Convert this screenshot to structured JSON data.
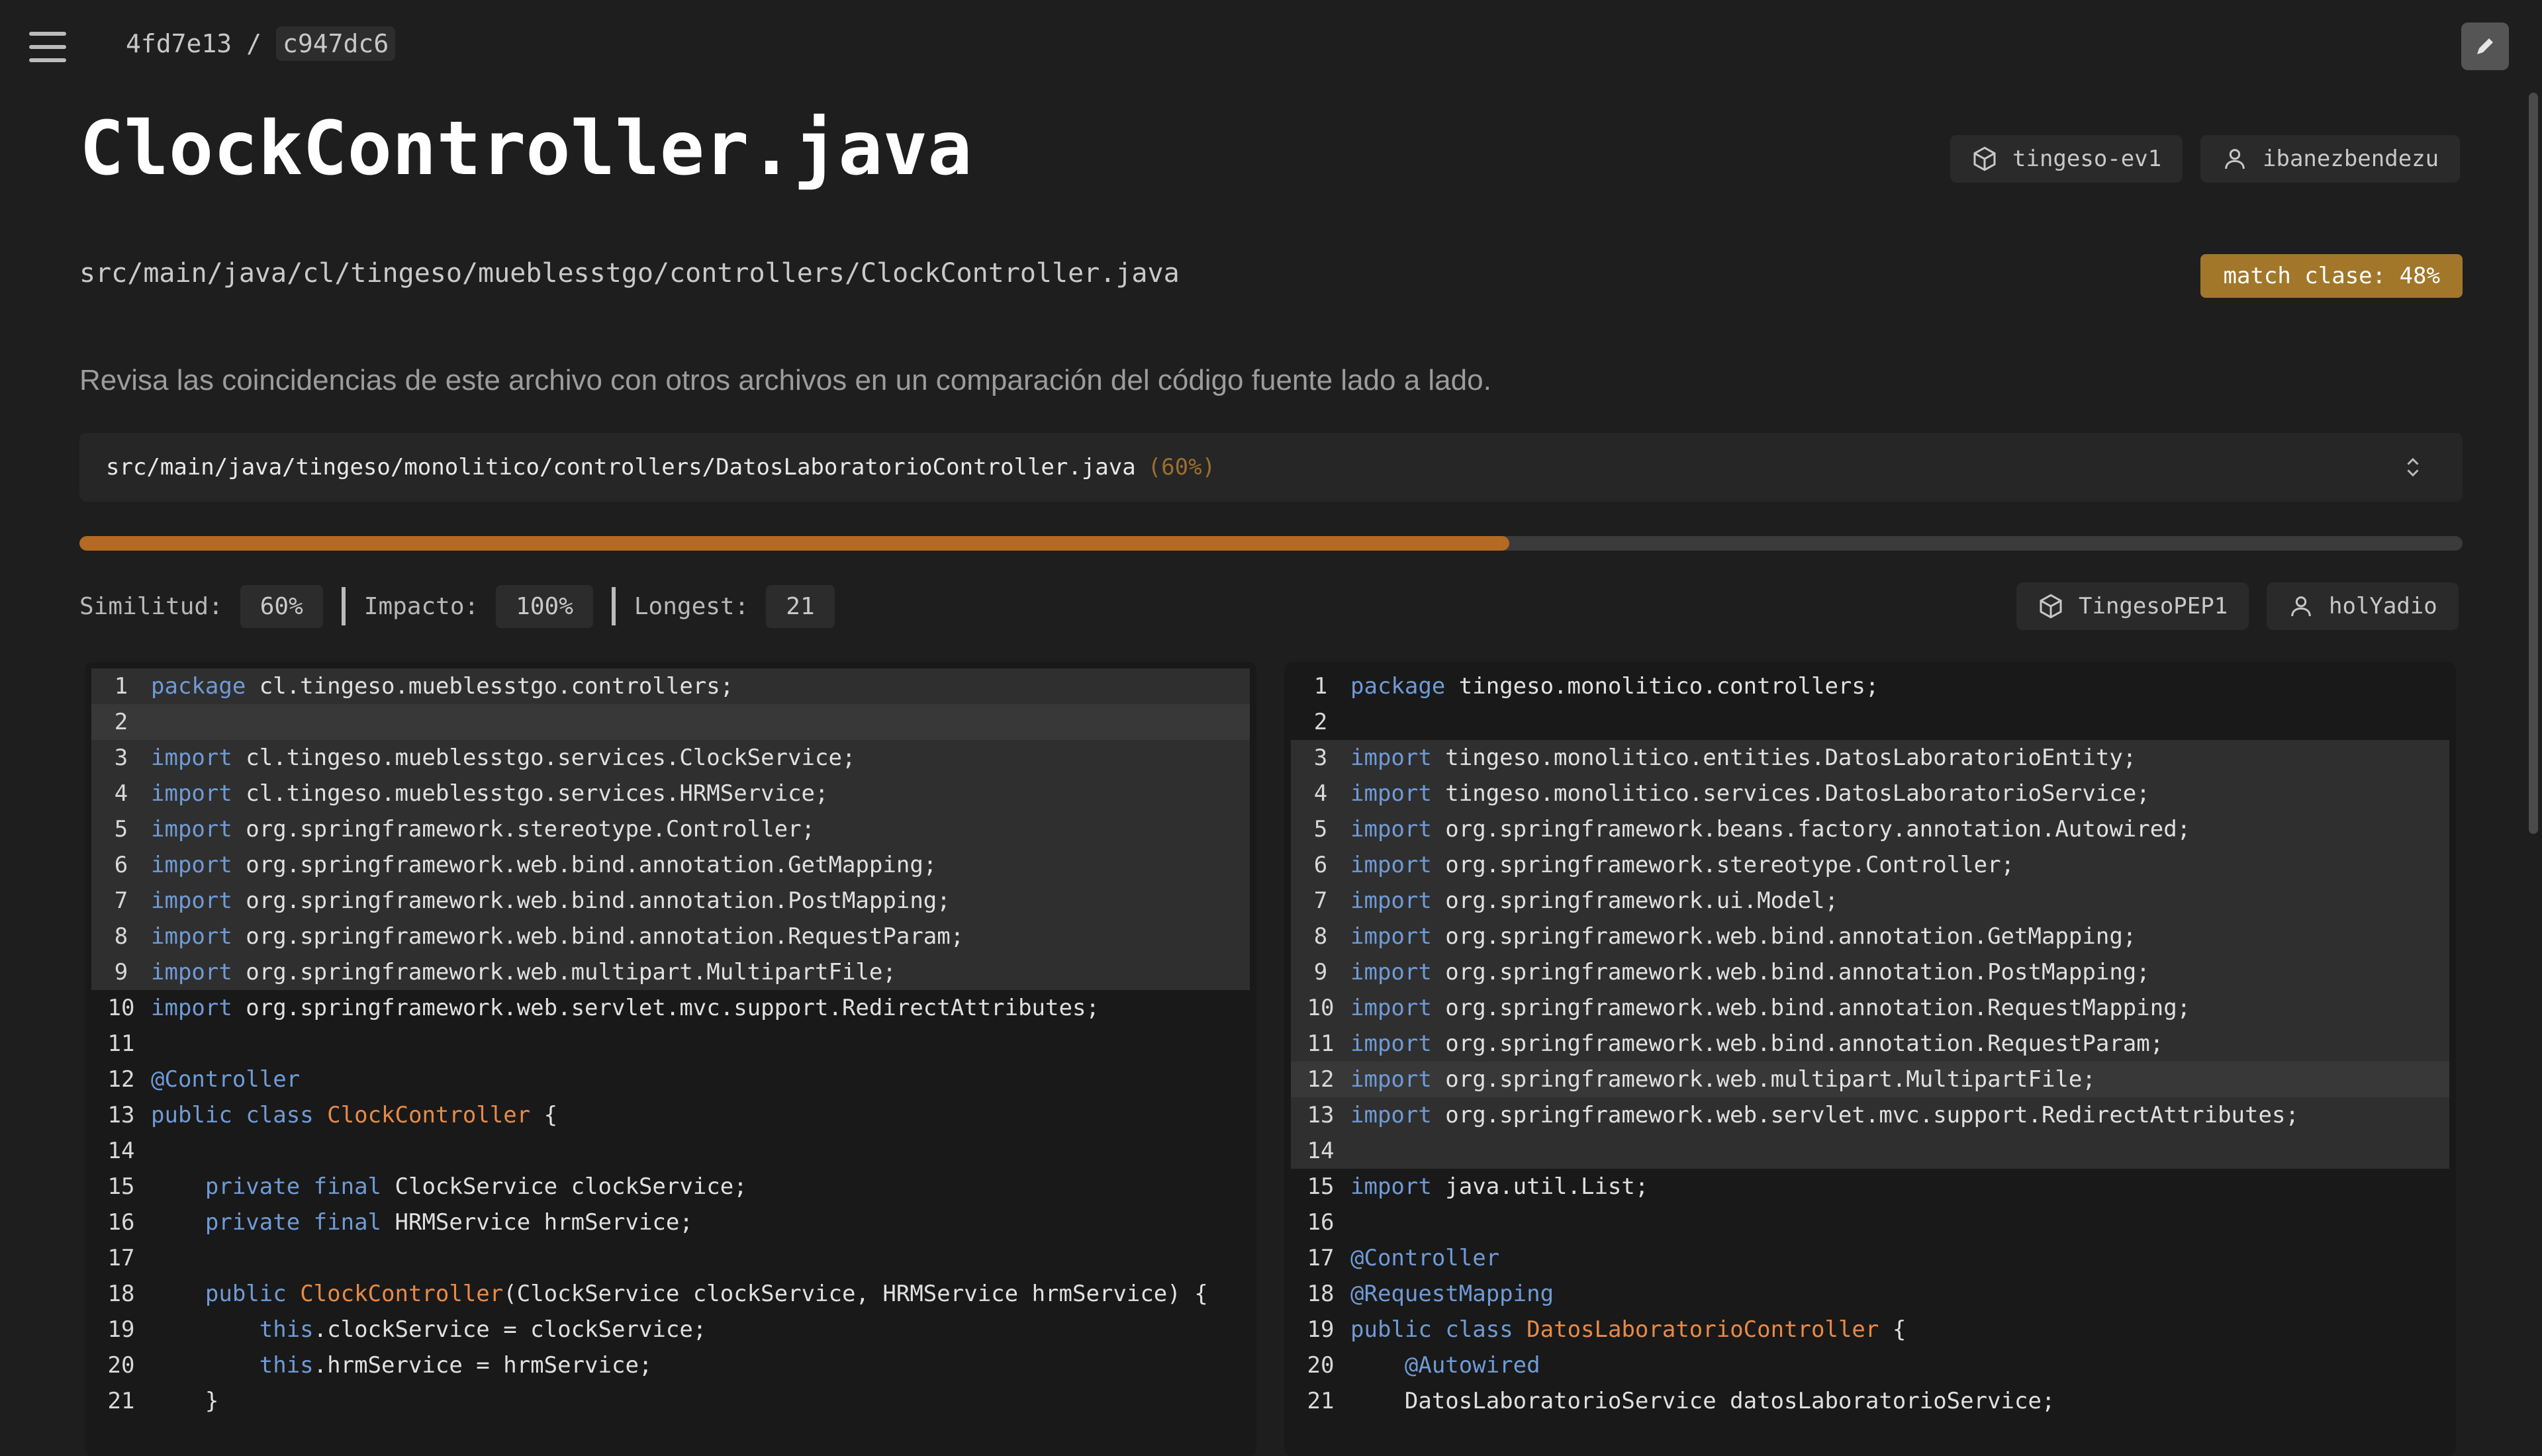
{
  "breadcrumb": {
    "commit_a": "4fd7e13",
    "separator": "/",
    "commit_b": "c947dc6"
  },
  "title": "ClockController.java",
  "repo": "tingeso-ev1",
  "user": "ibanezbendezu",
  "path": "src/main/java/cl/tingeso/mueblesstgo/controllers/ClockController.java",
  "match_badge": "match clase: 48%",
  "description": "Revisa las coincidencias de este archivo con otros archivos en un comparación del código fuente lado a lado.",
  "compare": {
    "file": "src/main/java/tingeso/monolitico/controllers/DatosLaboratorioController.java",
    "percent": "(60%)",
    "progress_fraction": 0.6
  },
  "stats": {
    "similitud_label": "Similitud:",
    "similitud": "60%",
    "impacto_label": "Impacto:",
    "impacto": "100%",
    "longest_label": "Longest:",
    "longest": "21",
    "other_repo": "TingesoPEP1",
    "other_user": "holYadio"
  },
  "colors": {
    "accent": "#b46a22",
    "badge": "#a2772a",
    "keyword": "#6f9bd6",
    "class": "#e88a47"
  },
  "left_code": [
    {
      "n": "1",
      "t": [
        [
          "kw",
          "package"
        ],
        [
          "txt",
          " cl.tingeso.mueblesstgo.controllers;"
        ]
      ],
      "hl": "hl"
    },
    {
      "n": "2",
      "t": [],
      "hl": "hl2"
    },
    {
      "n": "3",
      "t": [
        [
          "kw",
          "import"
        ],
        [
          "txt",
          " cl.tingeso.mueblesstgo.services.ClockService;"
        ]
      ],
      "hl": "hl"
    },
    {
      "n": "4",
      "t": [
        [
          "kw",
          "import"
        ],
        [
          "txt",
          " cl.tingeso.mueblesstgo.services.HRMService;"
        ]
      ],
      "hl": "hl"
    },
    {
      "n": "5",
      "t": [
        [
          "kw",
          "import"
        ],
        [
          "txt",
          " org.springframework.stereotype.Controller;"
        ]
      ],
      "hl": "hl"
    },
    {
      "n": "6",
      "t": [
        [
          "kw",
          "import"
        ],
        [
          "txt",
          " org.springframework.web.bind.annotation.GetMapping;"
        ]
      ],
      "hl": "hl"
    },
    {
      "n": "7",
      "t": [
        [
          "kw",
          "import"
        ],
        [
          "txt",
          " org.springframework.web.bind.annotation.PostMapping;"
        ]
      ],
      "hl": "hl"
    },
    {
      "n": "8",
      "t": [
        [
          "kw",
          "import"
        ],
        [
          "txt",
          " org.springframework.web.bind.annotation.RequestParam;"
        ]
      ],
      "hl": "hl"
    },
    {
      "n": "9",
      "t": [
        [
          "kw",
          "import"
        ],
        [
          "txt",
          " org.springframework.web.multipart.MultipartFile;"
        ]
      ],
      "hl": "hl"
    },
    {
      "n": "10",
      "t": [
        [
          "kw",
          "import"
        ],
        [
          "txt",
          " org.springframework.web.servlet.mvc.support.RedirectAttributes;"
        ]
      ],
      "hl": ""
    },
    {
      "n": "11",
      "t": [],
      "hl": ""
    },
    {
      "n": "12",
      "t": [
        [
          "ann",
          "@Controller"
        ]
      ],
      "hl": ""
    },
    {
      "n": "13",
      "t": [
        [
          "kw",
          "public"
        ],
        [
          "txt",
          " "
        ],
        [
          "kw",
          "class"
        ],
        [
          "txt",
          " "
        ],
        [
          "cls",
          "ClockController"
        ],
        [
          "txt",
          " {"
        ]
      ],
      "hl": ""
    },
    {
      "n": "14",
      "t": [],
      "hl": ""
    },
    {
      "n": "15",
      "t": [
        [
          "txt",
          "    "
        ],
        [
          "kw",
          "private"
        ],
        [
          "txt",
          " "
        ],
        [
          "kw",
          "final"
        ],
        [
          "txt",
          " ClockService clockService;"
        ]
      ],
      "hl": ""
    },
    {
      "n": "16",
      "t": [
        [
          "txt",
          "    "
        ],
        [
          "kw",
          "private"
        ],
        [
          "txt",
          " "
        ],
        [
          "kw",
          "final"
        ],
        [
          "txt",
          " HRMService hrmService;"
        ]
      ],
      "hl": ""
    },
    {
      "n": "17",
      "t": [],
      "hl": ""
    },
    {
      "n": "18",
      "t": [
        [
          "txt",
          "    "
        ],
        [
          "kw",
          "public"
        ],
        [
          "txt",
          " "
        ],
        [
          "cls",
          "ClockController"
        ],
        [
          "txt",
          "(ClockService clockService, HRMService hrmService) {"
        ]
      ],
      "hl": ""
    },
    {
      "n": "19",
      "t": [
        [
          "txt",
          "        "
        ],
        [
          "kw",
          "this"
        ],
        [
          "txt",
          ".clockService = clockService;"
        ]
      ],
      "hl": ""
    },
    {
      "n": "20",
      "t": [
        [
          "txt",
          "        "
        ],
        [
          "kw",
          "this"
        ],
        [
          "txt",
          ".hrmService = hrmService;"
        ]
      ],
      "hl": ""
    },
    {
      "n": "21",
      "t": [
        [
          "txt",
          "    }"
        ]
      ],
      "hl": ""
    }
  ],
  "right_code": [
    {
      "n": "1",
      "t": [
        [
          "kw",
          "package"
        ],
        [
          "txt",
          " tingeso.monolitico.controllers;"
        ]
      ],
      "hl": ""
    },
    {
      "n": "2",
      "t": [],
      "hl": ""
    },
    {
      "n": "3",
      "t": [
        [
          "kw",
          "import"
        ],
        [
          "txt",
          " tingeso.monolitico.entities.DatosLaboratorioEntity;"
        ]
      ],
      "hl": "hl"
    },
    {
      "n": "4",
      "t": [
        [
          "kw",
          "import"
        ],
        [
          "txt",
          " tingeso.monolitico.services.DatosLaboratorioService;"
        ]
      ],
      "hl": "hl"
    },
    {
      "n": "5",
      "t": [
        [
          "kw",
          "import"
        ],
        [
          "txt",
          " org.springframework.beans.factory.annotation.Autowired;"
        ]
      ],
      "hl": "hl"
    },
    {
      "n": "6",
      "t": [
        [
          "kw",
          "import"
        ],
        [
          "txt",
          " org.springframework.stereotype.Controller;"
        ]
      ],
      "hl": "hl"
    },
    {
      "n": "7",
      "t": [
        [
          "kw",
          "import"
        ],
        [
          "txt",
          " org.springframework.ui.Model;"
        ]
      ],
      "hl": "hl"
    },
    {
      "n": "8",
      "t": [
        [
          "kw",
          "import"
        ],
        [
          "txt",
          " org.springframework.web.bind.annotation.GetMapping;"
        ]
      ],
      "hl": "hl"
    },
    {
      "n": "9",
      "t": [
        [
          "kw",
          "import"
        ],
        [
          "txt",
          " org.springframework.web.bind.annotation.PostMapping;"
        ]
      ],
      "hl": "hl"
    },
    {
      "n": "10",
      "t": [
        [
          "kw",
          "import"
        ],
        [
          "txt",
          " org.springframework.web.bind.annotation.RequestMapping;"
        ]
      ],
      "hl": "hl"
    },
    {
      "n": "11",
      "t": [
        [
          "kw",
          "import"
        ],
        [
          "txt",
          " org.springframework.web.bind.annotation.RequestParam;"
        ]
      ],
      "hl": "hl"
    },
    {
      "n": "12",
      "t": [
        [
          "kw",
          "import"
        ],
        [
          "txt",
          " org.springframework.web.multipart.MultipartFile;"
        ]
      ],
      "hl": "hl2"
    },
    {
      "n": "13",
      "t": [
        [
          "kw",
          "import"
        ],
        [
          "txt",
          " org.springframework.web.servlet.mvc.support.RedirectAttributes;"
        ]
      ],
      "hl": "hl"
    },
    {
      "n": "14",
      "t": [],
      "hl": "hl"
    },
    {
      "n": "15",
      "t": [
        [
          "kw",
          "import"
        ],
        [
          "txt",
          " java.util.List;"
        ]
      ],
      "hl": ""
    },
    {
      "n": "16",
      "t": [],
      "hl": ""
    },
    {
      "n": "17",
      "t": [
        [
          "ann",
          "@Controller"
        ]
      ],
      "hl": ""
    },
    {
      "n": "18",
      "t": [
        [
          "ann",
          "@RequestMapping"
        ]
      ],
      "hl": ""
    },
    {
      "n": "19",
      "t": [
        [
          "kw",
          "public"
        ],
        [
          "txt",
          " "
        ],
        [
          "kw",
          "class"
        ],
        [
          "txt",
          " "
        ],
        [
          "cls",
          "DatosLaboratorioController"
        ],
        [
          "txt",
          " {"
        ]
      ],
      "hl": ""
    },
    {
      "n": "20",
      "t": [
        [
          "txt",
          "    "
        ],
        [
          "ann",
          "@Autowired"
        ]
      ],
      "hl": ""
    },
    {
      "n": "21",
      "t": [
        [
          "txt",
          "    DatosLaboratorioService datosLaboratorioService;"
        ]
      ],
      "hl": ""
    }
  ]
}
